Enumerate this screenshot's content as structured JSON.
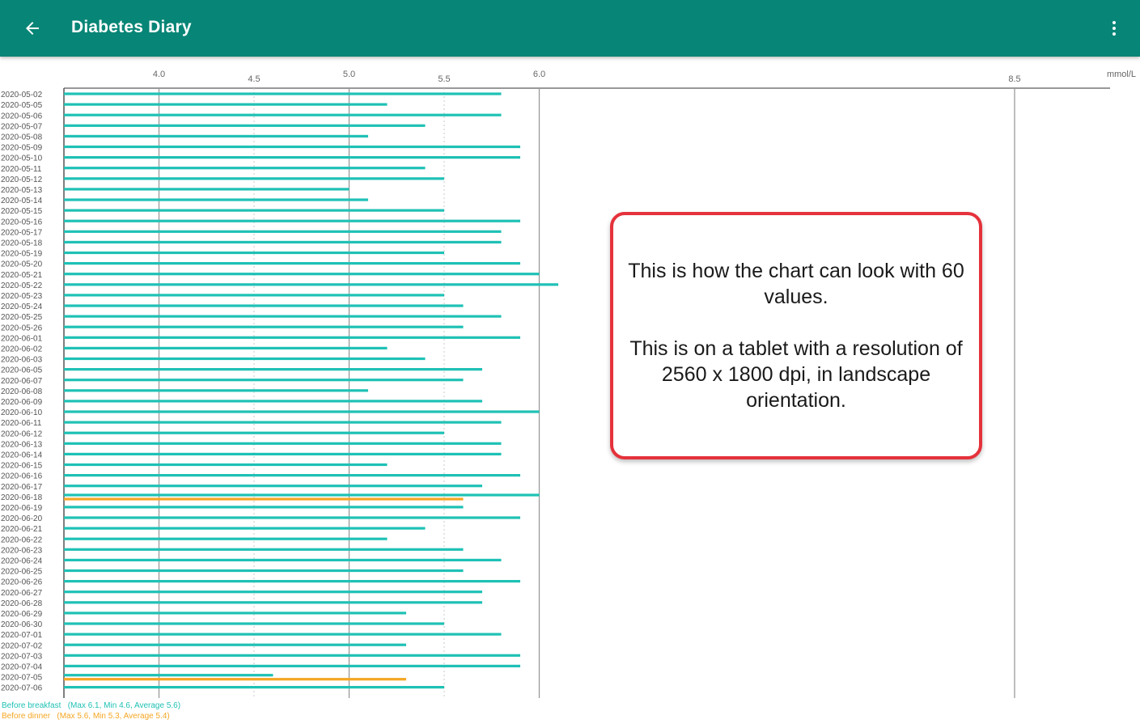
{
  "app_bar": {
    "title": "Diabetes Diary",
    "color": "#078576",
    "back_icon": "arrow-left-icon",
    "menu_icon": "more-vert-icon"
  },
  "callout": {
    "line1": "This is how the chart can look with 60 values.",
    "line2": "This is on a tablet with a resolution of 2560 x 1800 dpi, in landscape orientation."
  },
  "chart_data": {
    "type": "bar",
    "orientation": "horizontal",
    "unit_label": "mmol/L",
    "x_ticks": [
      "4.0",
      "4.5",
      "5.0",
      "5.5",
      "6.0",
      "8.5"
    ],
    "x_tick_values": [
      4.0,
      4.5,
      5.0,
      5.5,
      6.0,
      8.5
    ],
    "xlim": [
      3.5,
      9.0
    ],
    "grid": "vertical",
    "legend_position": "bottom-left",
    "series": [
      {
        "name": "Before breakfast",
        "color": "#1fc1b5",
        "summary": "(Max 6.1, Min 4.6, Average 5.6)"
      },
      {
        "name": "Before dinner",
        "color": "#f5a623",
        "summary": "(Max 5.6, Min 5.3, Average 5.4)"
      }
    ],
    "rows": [
      {
        "date": "2020-05-02",
        "values": [
          5.8
        ]
      },
      {
        "date": "2020-05-05",
        "values": [
          5.2
        ]
      },
      {
        "date": "2020-05-06",
        "values": [
          5.8
        ]
      },
      {
        "date": "2020-05-07",
        "values": [
          5.4
        ]
      },
      {
        "date": "2020-05-08",
        "values": [
          5.1
        ]
      },
      {
        "date": "2020-05-09",
        "values": [
          5.9
        ]
      },
      {
        "date": "2020-05-10",
        "values": [
          5.9
        ]
      },
      {
        "date": "2020-05-11",
        "values": [
          5.4
        ]
      },
      {
        "date": "2020-05-12",
        "values": [
          5.5
        ]
      },
      {
        "date": "2020-05-13",
        "values": [
          5.0
        ]
      },
      {
        "date": "2020-05-14",
        "values": [
          5.1
        ]
      },
      {
        "date": "2020-05-15",
        "values": [
          5.5
        ]
      },
      {
        "date": "2020-05-16",
        "values": [
          5.9
        ]
      },
      {
        "date": "2020-05-17",
        "values": [
          5.8
        ]
      },
      {
        "date": "2020-05-18",
        "values": [
          5.8
        ]
      },
      {
        "date": "2020-05-19",
        "values": [
          5.5
        ]
      },
      {
        "date": "2020-05-20",
        "values": [
          5.9
        ]
      },
      {
        "date": "2020-05-21",
        "values": [
          6.0
        ]
      },
      {
        "date": "2020-05-22",
        "values": [
          6.1
        ]
      },
      {
        "date": "2020-05-23",
        "values": [
          5.5
        ]
      },
      {
        "date": "2020-05-24",
        "values": [
          5.6
        ]
      },
      {
        "date": "2020-05-25",
        "values": [
          5.8
        ]
      },
      {
        "date": "2020-05-26",
        "values": [
          5.6
        ]
      },
      {
        "date": "2020-06-01",
        "values": [
          5.9
        ]
      },
      {
        "date": "2020-06-02",
        "values": [
          5.2
        ]
      },
      {
        "date": "2020-06-03",
        "values": [
          5.4
        ]
      },
      {
        "date": "2020-06-05",
        "values": [
          5.7
        ]
      },
      {
        "date": "2020-06-07",
        "values": [
          5.6
        ]
      },
      {
        "date": "2020-06-08",
        "values": [
          5.1
        ]
      },
      {
        "date": "2020-06-09",
        "values": [
          5.7
        ]
      },
      {
        "date": "2020-06-10",
        "values": [
          6.0
        ]
      },
      {
        "date": "2020-06-11",
        "values": [
          5.8
        ]
      },
      {
        "date": "2020-06-12",
        "values": [
          5.5
        ]
      },
      {
        "date": "2020-06-13",
        "values": [
          5.8
        ]
      },
      {
        "date": "2020-06-14",
        "values": [
          5.8
        ]
      },
      {
        "date": "2020-06-15",
        "values": [
          5.2
        ]
      },
      {
        "date": "2020-06-16",
        "values": [
          5.9
        ]
      },
      {
        "date": "2020-06-17",
        "values": [
          5.7
        ]
      },
      {
        "date": "2020-06-18",
        "values": [
          6.0,
          5.6
        ]
      },
      {
        "date": "2020-06-19",
        "values": [
          5.6
        ]
      },
      {
        "date": "2020-06-20",
        "values": [
          5.9
        ]
      },
      {
        "date": "2020-06-21",
        "values": [
          5.4
        ]
      },
      {
        "date": "2020-06-22",
        "values": [
          5.2
        ]
      },
      {
        "date": "2020-06-23",
        "values": [
          5.6
        ]
      },
      {
        "date": "2020-06-24",
        "values": [
          5.8
        ]
      },
      {
        "date": "2020-06-25",
        "values": [
          5.6
        ]
      },
      {
        "date": "2020-06-26",
        "values": [
          5.9
        ]
      },
      {
        "date": "2020-06-27",
        "values": [
          5.7
        ]
      },
      {
        "date": "2020-06-28",
        "values": [
          5.7
        ]
      },
      {
        "date": "2020-06-29",
        "values": [
          5.3
        ]
      },
      {
        "date": "2020-06-30",
        "values": [
          5.5
        ]
      },
      {
        "date": "2020-07-01",
        "values": [
          5.8
        ]
      },
      {
        "date": "2020-07-02",
        "values": [
          5.3
        ]
      },
      {
        "date": "2020-07-03",
        "values": [
          5.9
        ]
      },
      {
        "date": "2020-07-04",
        "values": [
          5.9
        ]
      },
      {
        "date": "2020-07-05",
        "values": [
          4.6,
          5.3
        ]
      },
      {
        "date": "2020-07-06",
        "values": [
          5.5
        ]
      }
    ]
  }
}
